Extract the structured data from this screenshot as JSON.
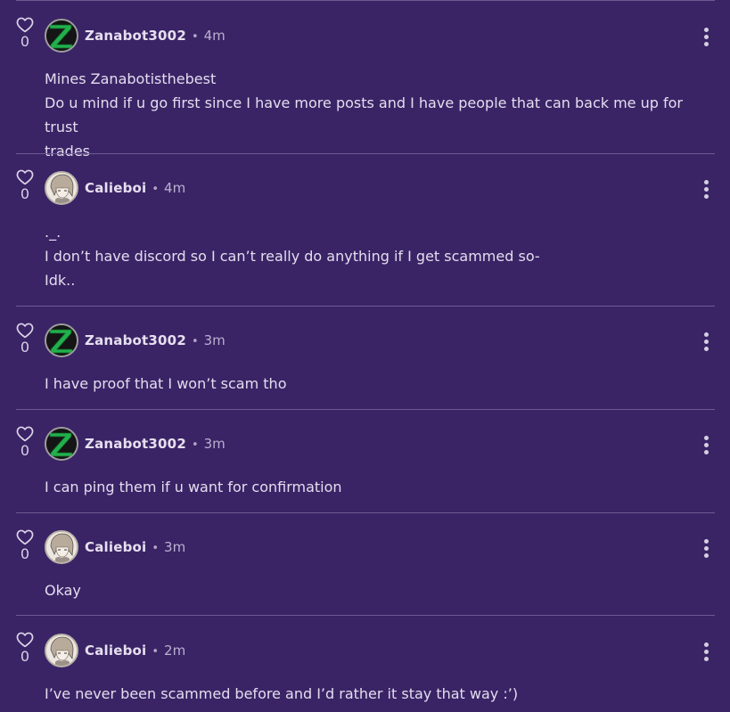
{
  "comments": [
    {
      "author": "Zanabot3002",
      "time": "4m",
      "likes": "0",
      "avatar": "green-z-logo-avatar",
      "lines": [
        "Mines Zanabotisthebest",
        "Do u mind if u go first since I have more posts and I have people that can back me up for trust",
        "trades"
      ]
    },
    {
      "author": "Calieboi",
      "time": "4m",
      "likes": "0",
      "avatar": "anime-character-avatar",
      "lines": [
        "._.",
        "I don’t have discord so I can’t really do anything if I get scammed so-",
        "Idk.."
      ]
    },
    {
      "author": "Zanabot3002",
      "time": "3m",
      "likes": "0",
      "avatar": "green-z-logo-avatar",
      "lines": [
        "I have proof that I won’t scam tho"
      ]
    },
    {
      "author": "Zanabot3002",
      "time": "3m",
      "likes": "0",
      "avatar": "green-z-logo-avatar",
      "lines": [
        "I can ping them if u want for confirmation"
      ]
    },
    {
      "author": "Calieboi",
      "time": "3m",
      "likes": "0",
      "avatar": "anime-character-avatar",
      "lines": [
        "Okay"
      ]
    },
    {
      "author": "Calieboi",
      "time": "2m",
      "likes": "0",
      "avatar": "anime-character-avatar",
      "lines": [
        "I’ve never been scammed before and I’d rather it stay that way :’)"
      ]
    }
  ],
  "colors": {
    "background": "#3a2466",
    "divider": "#6d5a92",
    "text": "#e4ddee",
    "z_logo": "#22b14c"
  },
  "icons": {
    "like": "heart-outline-icon",
    "menu": "more-vertical-icon"
  },
  "separator": "•"
}
